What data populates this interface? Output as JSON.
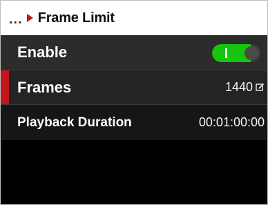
{
  "header": {
    "ellipsis": "...",
    "title": "Frame Limit"
  },
  "rows": {
    "enable": {
      "label": "Enable",
      "toggle_on": true
    },
    "frames": {
      "label": "Frames",
      "value": "1440",
      "selected": true,
      "icon": "edit-icon"
    },
    "duration": {
      "label": "Playback Duration",
      "value": "00:01:00:00"
    }
  },
  "colors": {
    "accent": "#c4161c",
    "toggle_on": "#16c60c",
    "header_bg": "#ffffff",
    "screen_bg": "#000000"
  }
}
